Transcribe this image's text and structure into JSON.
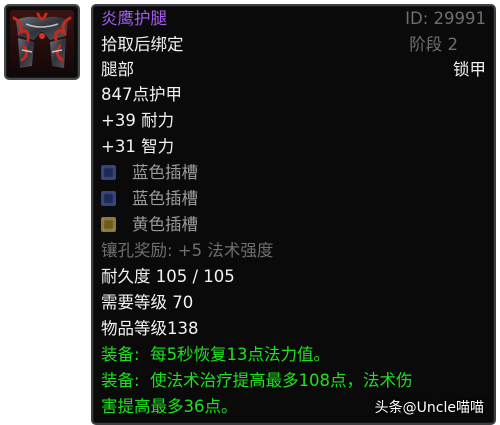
{
  "item": {
    "name": "炎鹰护腿",
    "id_label": "ID: 29991",
    "bind": "拾取后绑定",
    "stage": "阶段 2",
    "slot": "腿部",
    "armor_type": "锁甲",
    "armor": "847点护甲",
    "stats": [
      "+39 耐力",
      "+31 智力"
    ],
    "sockets": [
      {
        "color": "blue",
        "label": "蓝色插槽"
      },
      {
        "color": "blue",
        "label": "蓝色插槽"
      },
      {
        "color": "yellow",
        "label": "黄色插槽"
      }
    ],
    "socket_bonus": "镶孔奖励: +5 法术强度",
    "durability": "耐久度 105 / 105",
    "required_level": "需要等级 70",
    "item_level": "物品等级138",
    "equip_effects": [
      {
        "prefix": "装备:",
        "text": "每5秒恢复13点法力值。"
      },
      {
        "prefix": "装备:",
        "text": "使法术治疗提高最多108点，法术伤",
        "text2": "害提高最多36点。"
      }
    ]
  },
  "colors": {
    "title": "#a45cf0",
    "white": "#f2f2f2",
    "grey": "#6e6e6e",
    "green": "#1ee01e",
    "background": "#0a0a0b"
  },
  "icon": "mail-leggings-icon",
  "watermark": "头条@Uncle喵喵"
}
